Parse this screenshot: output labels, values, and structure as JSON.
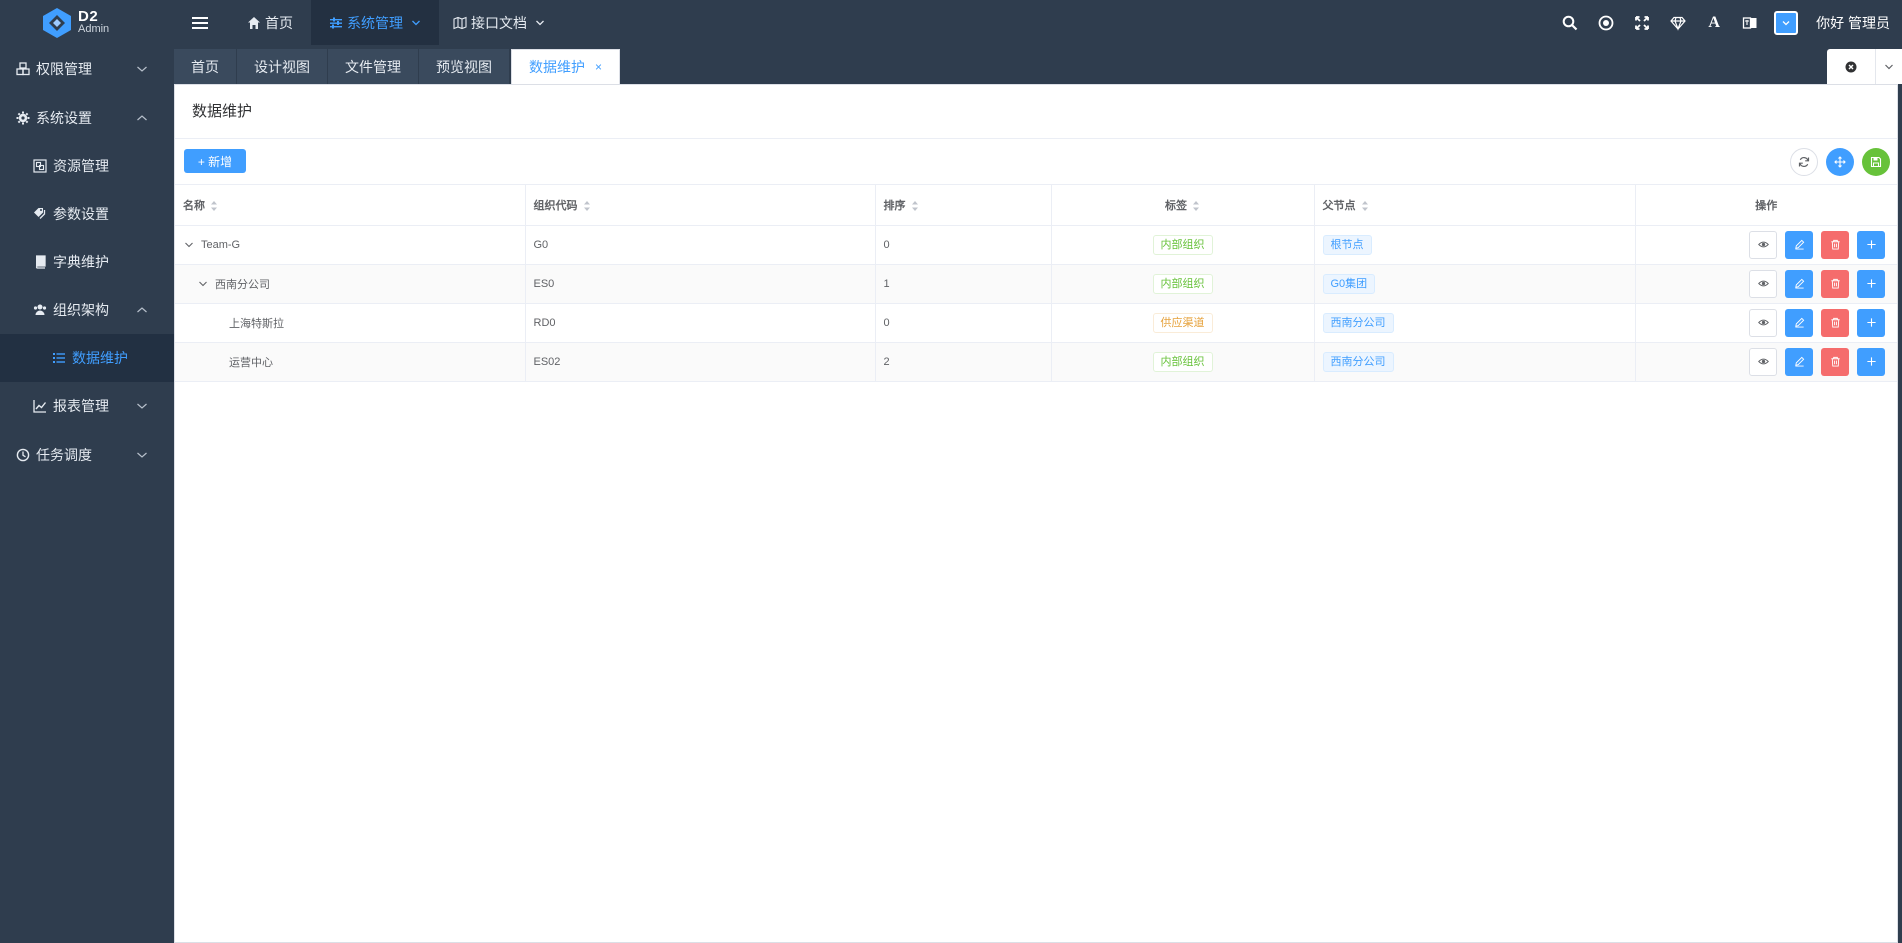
{
  "brand": {
    "name": "D2",
    "sub": "Admin"
  },
  "topnav": [
    {
      "label": "首页",
      "icon": "home-icon"
    },
    {
      "label": "系统管理",
      "icon": "sliders-icon",
      "active": true
    },
    {
      "label": "接口文档",
      "icon": "map-icon"
    }
  ],
  "header": {
    "user": "你好 管理员"
  },
  "sidebar": [
    {
      "label": "权限管理",
      "icon": "cubes-icon",
      "level": 1
    },
    {
      "label": "系统设置",
      "icon": "cog-icon",
      "level": 1,
      "open": true
    },
    {
      "label": "资源管理",
      "icon": "object-group-icon",
      "level": 2
    },
    {
      "label": "参数设置",
      "icon": "tags-icon",
      "level": 2
    },
    {
      "label": "字典维护",
      "icon": "book-icon",
      "level": 2
    },
    {
      "label": "组织架构",
      "icon": "users-icon",
      "level": 2,
      "open": true
    },
    {
      "label": "数据维护",
      "icon": "list-icon",
      "level": 3,
      "active": true
    },
    {
      "label": "报表管理",
      "icon": "chart-line-icon",
      "level": 2
    },
    {
      "label": "任务调度",
      "icon": "clock-icon",
      "level": 1
    }
  ],
  "tabs": [
    {
      "label": "首页"
    },
    {
      "label": "设计视图"
    },
    {
      "label": "文件管理"
    },
    {
      "label": "预览视图"
    },
    {
      "label": "数据维护",
      "active": true,
      "close": "×"
    }
  ],
  "page": {
    "title": "数据维护",
    "add_label": "+ 新增"
  },
  "table": {
    "columns": [
      "名称",
      "组织代码",
      "排序",
      "标签",
      "父节点",
      "操作"
    ],
    "rows": [
      {
        "name": "Team-G",
        "code": "G0",
        "sort": "0",
        "tag": "内部组织",
        "tag_color": "green",
        "parent": "根节点",
        "indent": 0,
        "expand": true
      },
      {
        "name": "西南分公司",
        "code": "ES0",
        "sort": "1",
        "tag": "内部组织",
        "tag_color": "green",
        "parent": "G0集团",
        "indent": 1,
        "expand": true
      },
      {
        "name": "上海特斯拉",
        "code": "RD0",
        "sort": "0",
        "tag": "供应渠道",
        "tag_color": "orange",
        "parent": "西南分公司",
        "indent": 2,
        "expand": false
      },
      {
        "name": "运营中心",
        "code": "ES02",
        "sort": "2",
        "tag": "内部组织",
        "tag_color": "green",
        "parent": "西南分公司",
        "indent": 2,
        "expand": false
      }
    ]
  },
  "colors": {
    "primary": "#409eff",
    "success": "#67c23a",
    "danger": "#f56c6c",
    "warning": "#e6a23c",
    "sidebar_bg": "#2f3d4e"
  }
}
